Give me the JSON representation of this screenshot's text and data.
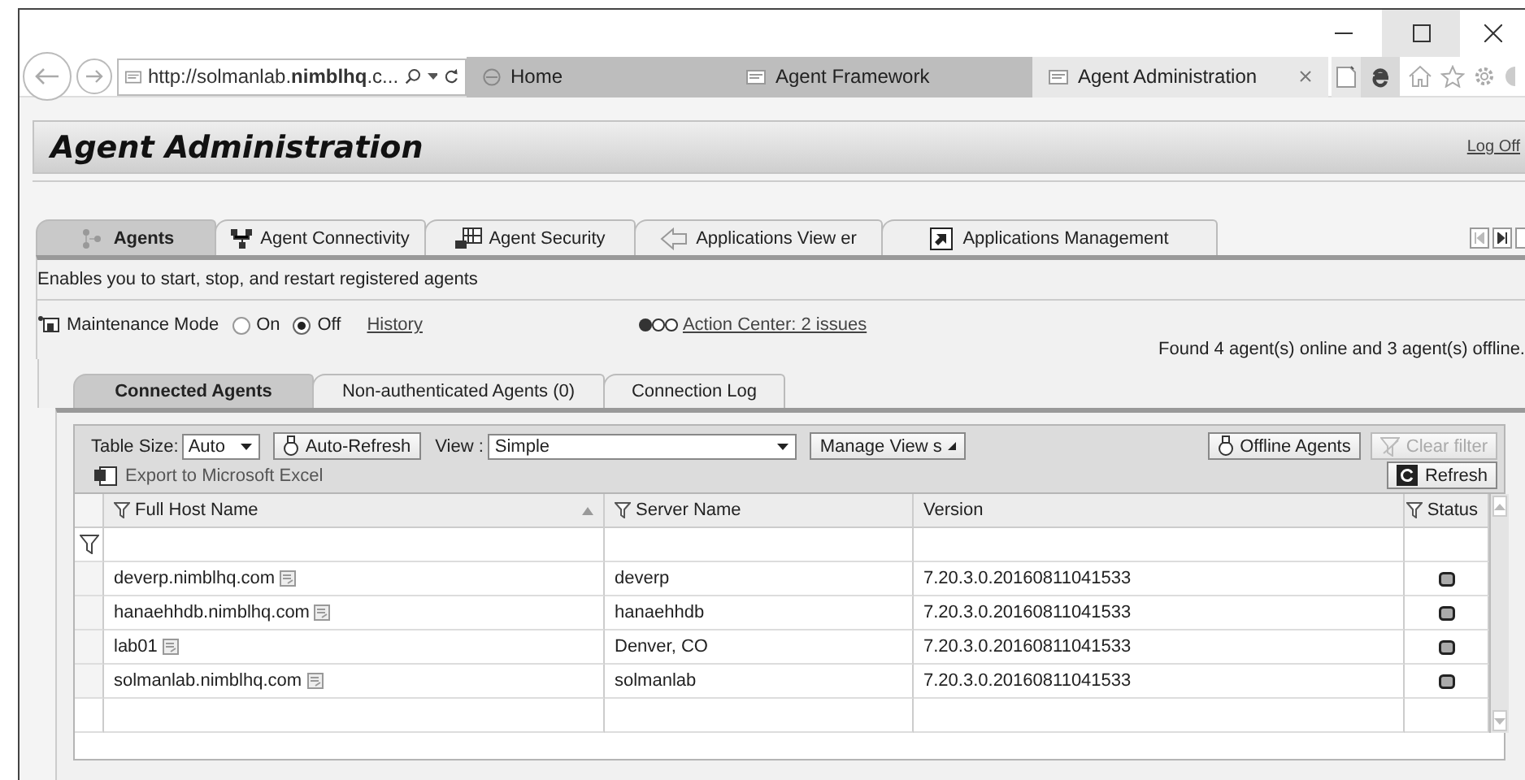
{
  "browser": {
    "address": "http://solmanlab.**nimblhq**.c...",
    "tabs": [
      {
        "label": "Home",
        "selected": false
      },
      {
        "label": "Agent Framework",
        "selected": false
      },
      {
        "label": "Agent Administration",
        "selected": true
      }
    ]
  },
  "header": {
    "title": "Agent Administration",
    "log_off": "Log Off"
  },
  "tabs": [
    {
      "label": "Agents",
      "selected": true
    },
    {
      "label": "Agent Connectivity",
      "selected": false
    },
    {
      "label": "Agent Security",
      "selected": false
    },
    {
      "label": "Applications View er",
      "selected": false
    },
    {
      "label": "Applications Management",
      "selected": false
    }
  ],
  "description": "Enables you to start, stop, and restart registered agents",
  "maintenance": {
    "label": "Maintenance Mode",
    "options": [
      {
        "label": "On",
        "selected": false
      },
      {
        "label": "Off",
        "selected": true
      }
    ],
    "history": "History"
  },
  "action_center": "Action Center: 2 issues",
  "found": "Found 4 agent(s) online and 3 agent(s) offline.",
  "subtabs": [
    {
      "label": "Connected Agents",
      "selected": true
    },
    {
      "label": "Non-authenticated Agents (0)",
      "selected": false
    },
    {
      "label": "Connection Log",
      "selected": false
    }
  ],
  "toolbar": {
    "table_size_label": "Table Size:",
    "table_size": "Auto",
    "auto_refresh": "Auto-Refresh",
    "view_label": "View :",
    "view": "Simple",
    "manage_views": "Manage View s",
    "offline_agents": "Offline Agents",
    "clear_filter": {
      "label": "Clear filter",
      "disabled": true
    },
    "refresh": "Refresh",
    "export": "Export to Microsoft Excel"
  },
  "table": {
    "columns": [
      {
        "label": "Full Host Name",
        "filter": true,
        "sorted": true
      },
      {
        "label": "Server Name",
        "filter": true,
        "sorted": false
      },
      {
        "label": "Version",
        "filter": false,
        "sorted": false
      },
      {
        "label": "Status",
        "filter": true,
        "sorted": false
      }
    ],
    "rows": [
      {
        "host": "deverp.nimblhq.com",
        "server": "deverp",
        "version": "7.20.3.0.20160811041533"
      },
      {
        "host": "hanaehhdb.nimblhq.com",
        "server": "hanaehhdb",
        "version": "7.20.3.0.20160811041533"
      },
      {
        "host": "lab01",
        "server": "Denver, CO",
        "version": "7.20.3.0.20160811041533"
      },
      {
        "host": "solmanlab.nimblhq.com",
        "server": "solmanlab",
        "version": "7.20.3.0.20160811041533"
      }
    ]
  }
}
